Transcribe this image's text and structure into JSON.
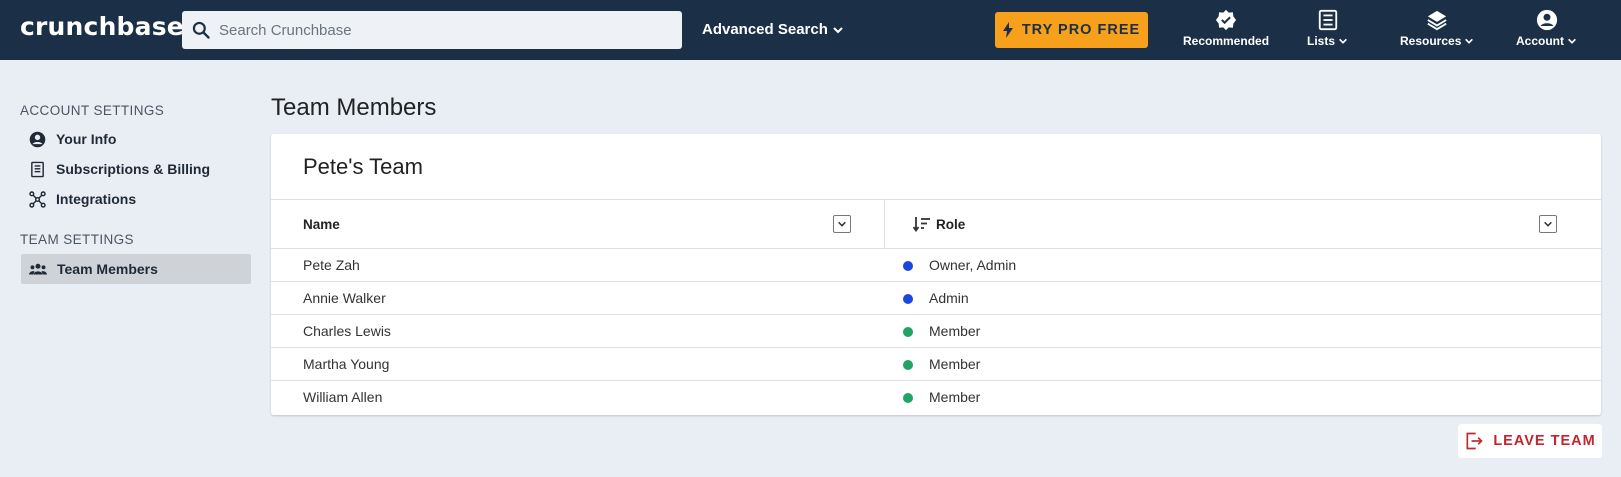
{
  "header": {
    "logo": "crunchbase",
    "search_placeholder": "Search Crunchbase",
    "advanced_search": "Advanced Search",
    "pro_button": "TRY PRO FREE",
    "nav": [
      {
        "label": "Recommended",
        "icon": "verified-badge-icon"
      },
      {
        "label": "Lists",
        "icon": "list-icon"
      },
      {
        "label": "Resources",
        "icon": "layers-icon"
      },
      {
        "label": "Account",
        "icon": "account-circle-icon"
      }
    ]
  },
  "sidebar": {
    "account_heading": "ACCOUNT SETTINGS",
    "account_items": [
      {
        "label": "Your Info",
        "icon": "account-circle-icon"
      },
      {
        "label": "Subscriptions & Billing",
        "icon": "receipt-icon"
      },
      {
        "label": "Integrations",
        "icon": "integrations-icon"
      }
    ],
    "team_heading": "TEAM SETTINGS",
    "team_items": [
      {
        "label": "Team Members",
        "icon": "people-icon",
        "active": true
      }
    ]
  },
  "main": {
    "page_title": "Team Members",
    "team_name": "Pete's Team",
    "columns": {
      "name": "Name",
      "role": "Role"
    },
    "members": [
      {
        "name": "Pete Zah",
        "role": "Owner, Admin",
        "dot_color": "#1a47e0"
      },
      {
        "name": "Annie Walker",
        "role": "Admin",
        "dot_color": "#1a47e0"
      },
      {
        "name": "Charles Lewis",
        "role": "Member",
        "dot_color": "#21a366"
      },
      {
        "name": "Martha Young",
        "role": "Member",
        "dot_color": "#21a366"
      },
      {
        "name": "William Allen",
        "role": "Member",
        "dot_color": "#21a366"
      }
    ],
    "leave_button": "LEAVE TEAM"
  },
  "colors": {
    "nav_bg": "#1b3046",
    "accent": "#f7a01c",
    "danger": "#c0262d"
  }
}
